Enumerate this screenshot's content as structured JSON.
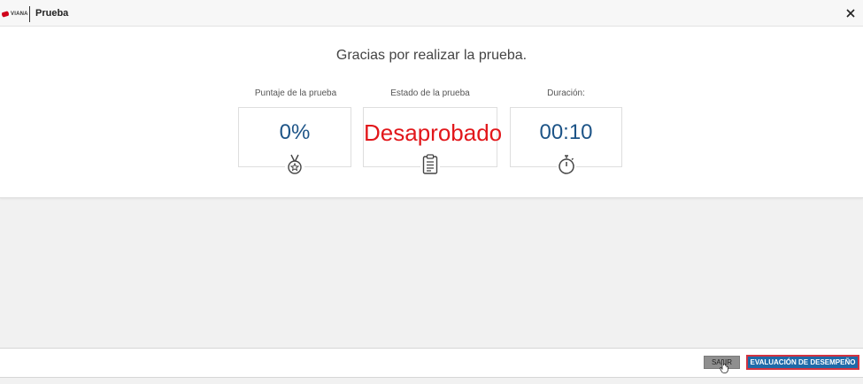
{
  "window": {
    "logo_text": "VIANA",
    "title": "Prueba"
  },
  "main": {
    "headline": "Gracias por realizar la prueba.",
    "stats": [
      {
        "label": "Puntaje de la prueba",
        "value": "0%",
        "icon": "medal-icon"
      },
      {
        "label": "Estado de la prueba",
        "value": "Desaprobado",
        "icon": "clipboard-icon"
      },
      {
        "label": "Duración:",
        "value": "00:10",
        "icon": "stopwatch-icon"
      }
    ]
  },
  "colors": {
    "value_blue": "#1d5487",
    "fail_red": "#e2171b",
    "primary_button": "#1e6aa9"
  },
  "footer": {
    "exit_label": "SALIR",
    "eval_label": "EVALUACIÓN DE DESEMPEÑO"
  }
}
